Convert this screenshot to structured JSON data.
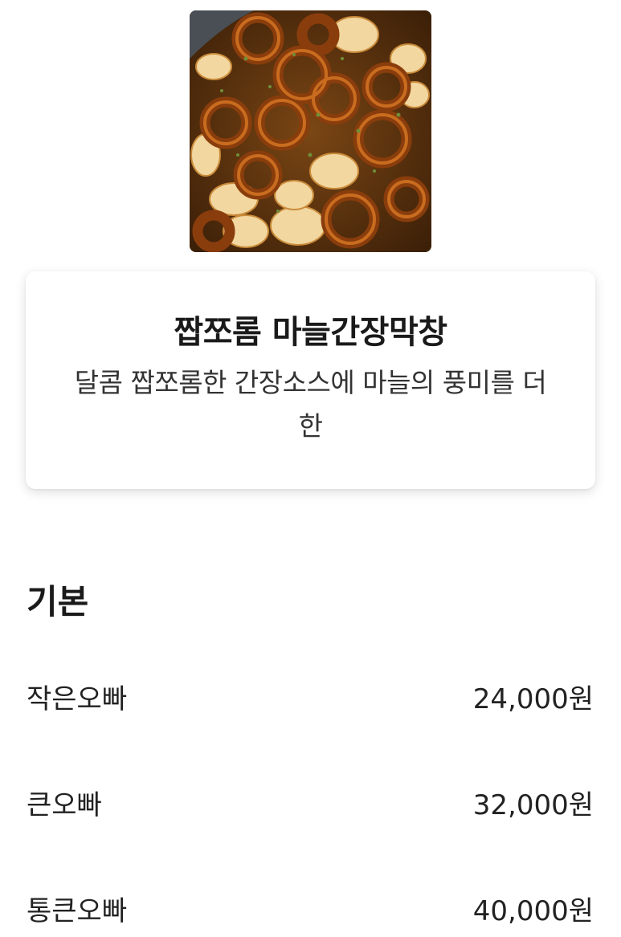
{
  "menu": {
    "image_name": "garlic soy sauce makchang photo",
    "title": "짭쪼롬 마늘간장막창",
    "description": "달콤 짭쪼롬한 간장소스에 마늘의 풍미를 더한"
  },
  "options_section": {
    "title": "기본",
    "items": [
      {
        "name": "작은오빠",
        "price": "24,000원"
      },
      {
        "name": "큰오빠",
        "price": "32,000원"
      },
      {
        "name": "통큰오빠",
        "price": "40,000원"
      }
    ]
  },
  "colors": {
    "background": "#ffffff",
    "text": "#222222",
    "card_shadow": "rgba(0,0,0,0.13)"
  }
}
